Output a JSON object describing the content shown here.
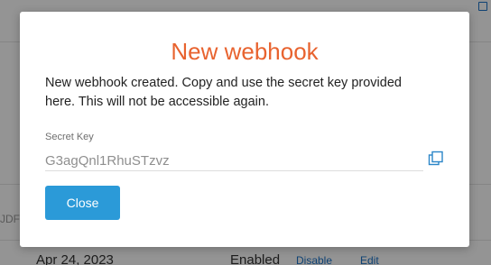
{
  "background": {
    "row_date": "Apr 24, 2023",
    "row_status": "Enabled",
    "row_action_disable": "Disable",
    "row_action_edit": "Edit",
    "left_fragment": "JDF"
  },
  "modal": {
    "title": "New webhook",
    "message": "New webhook created. Copy and use the secret key provided here. This will not be accessible again.",
    "secret_label": "Secret Key",
    "secret_value": "G3agQnl1RhuSTzvz",
    "close_label": "Close"
  },
  "colors": {
    "title_accent": "#e8632f",
    "button_primary": "#2b9ad8",
    "link": "#1a73c9"
  },
  "icons": {
    "copy": "copy-icon"
  }
}
